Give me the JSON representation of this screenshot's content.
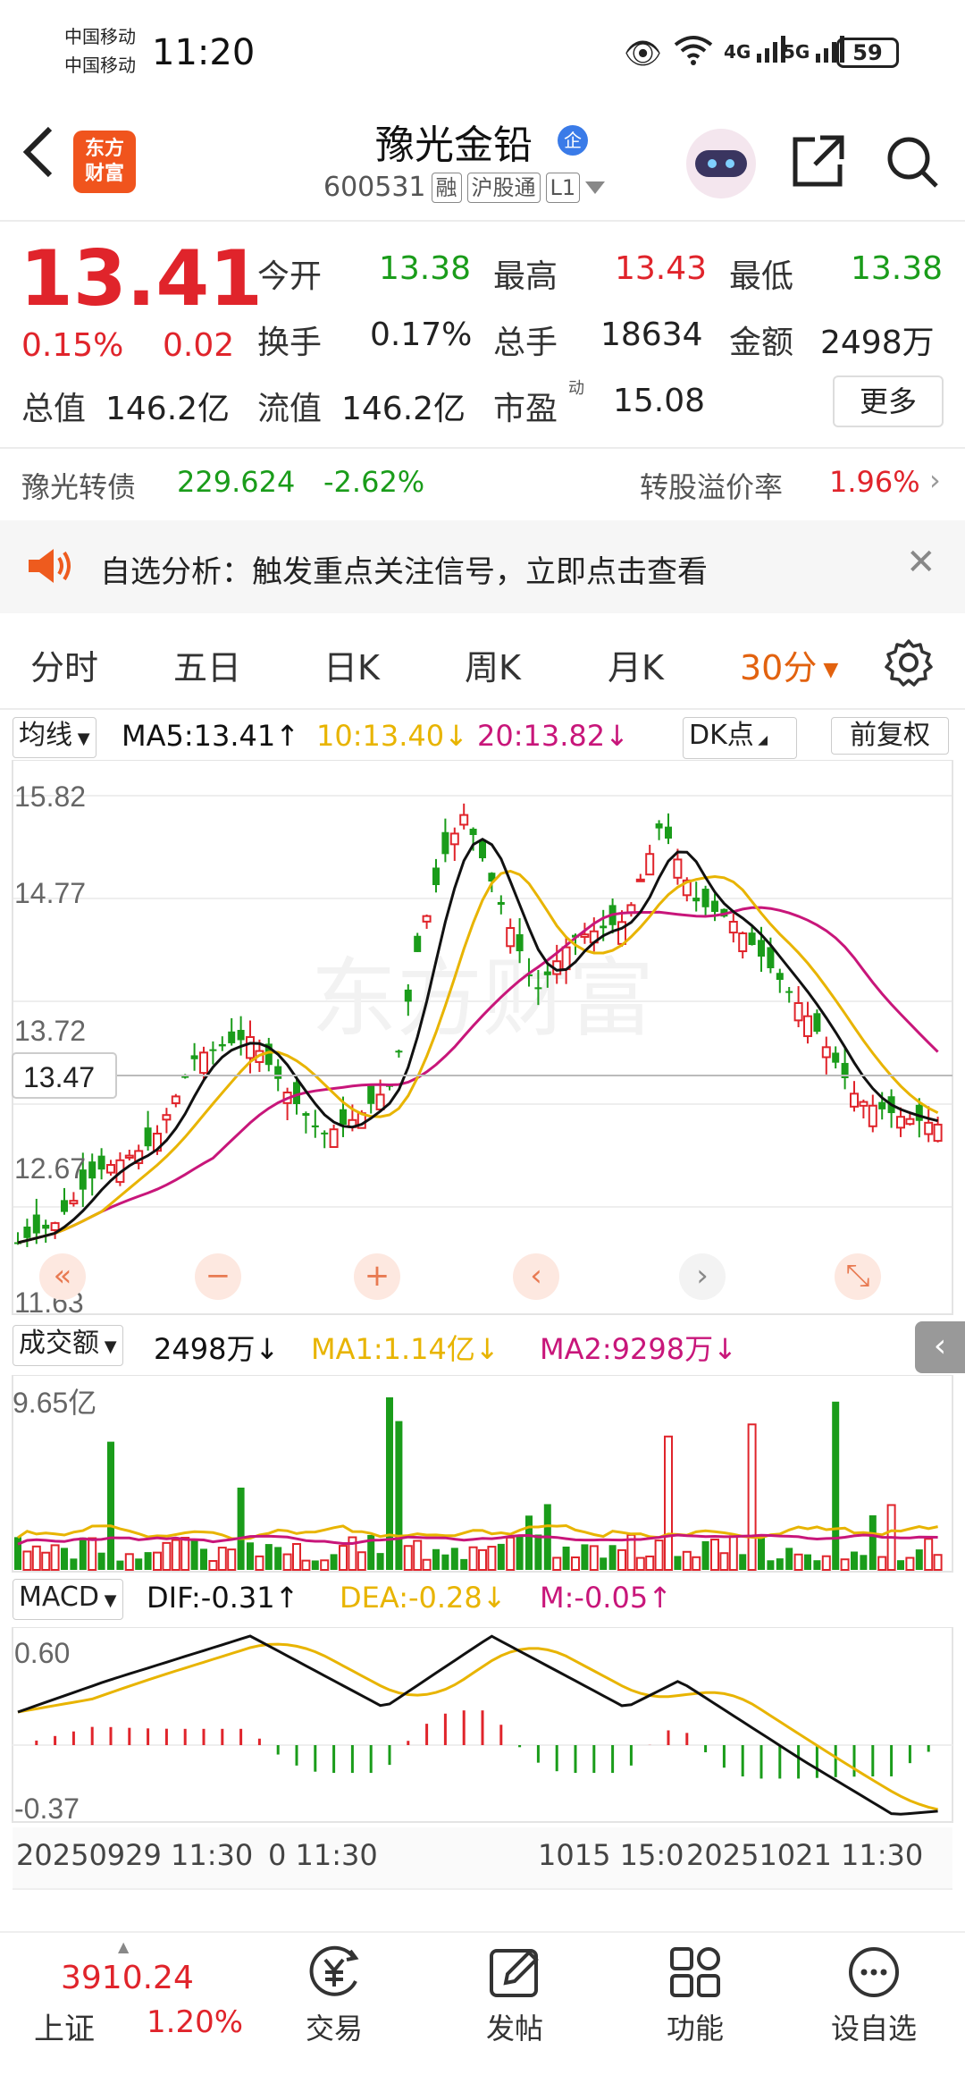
{
  "status_bar": {
    "carrier1": "中国移动",
    "carrier2": "中国移动",
    "time": "11:20",
    "signal1": "4G",
    "signal2": "5G",
    "battery": "59"
  },
  "header": {
    "logo_line1": "东方",
    "logo_line2": "财富",
    "title": "豫光金铅",
    "badge": "企",
    "code": "600531",
    "tags": [
      "融",
      "沪股通",
      "L1"
    ]
  },
  "quote": {
    "price": "13.41",
    "change_pct": "0.15%",
    "change_amt": "0.02",
    "open_label": "今开",
    "open": "13.38",
    "high_label": "最高",
    "high": "13.43",
    "low_label": "最低",
    "low": "13.38",
    "turnover_label": "换手",
    "turnover": "0.17%",
    "volume_label": "总手",
    "volume": "18634",
    "amount_label": "金额",
    "amount": "2498万",
    "mcap_label": "总值",
    "mcap": "146.2亿",
    "float_label": "流值",
    "float": "146.2亿",
    "pe_label": "市盈",
    "pe_sup": "动",
    "pe": "15.08",
    "more": "更多"
  },
  "bond": {
    "name": "豫光转债",
    "price": "229.624",
    "change": "-2.62%",
    "premium_label": "转股溢价率",
    "premium": "1.96%"
  },
  "notice": {
    "text": "自选分析：触发重点关注信号，立即点击查看"
  },
  "tabs": [
    {
      "label": "分时"
    },
    {
      "label": "五日"
    },
    {
      "label": "日K"
    },
    {
      "label": "周K"
    },
    {
      "label": "月K"
    },
    {
      "label": "30分"
    }
  ],
  "main_chart": {
    "indicator": "均线",
    "ma5": "MA5:13.41",
    "ma10": "10:13.40",
    "ma20": "20:13.82",
    "dk": "DK点",
    "adjust": "前复权",
    "y_labels": [
      "15.82",
      "14.77",
      "13.72",
      "12.67",
      "11.63"
    ],
    "current_price": "13.47",
    "watermark": "东方财富"
  },
  "volume_chart": {
    "indicator": "成交额",
    "value": "2498万",
    "ma1": "MA1:1.14亿",
    "ma2": "MA2:9298万",
    "y_max": "9.65亿"
  },
  "macd_chart": {
    "indicator": "MACD",
    "dif": "DIF:-0.31",
    "dea": "DEA:-0.28",
    "m": "M:-0.05",
    "y_top": "0.60",
    "y_bottom": "-0.37"
  },
  "x_axis": {
    "left": "20250929 11:30",
    "mid1": "0 11:30",
    "mid2": "1015 15:0",
    "right": "20251021 11:30"
  },
  "bottom_nav": {
    "index_value": "3910.24",
    "index_name": "上证",
    "index_change": "1.20%",
    "items": [
      {
        "label": "交易",
        "icon": "yen-icon"
      },
      {
        "label": "发帖",
        "icon": "edit-icon"
      },
      {
        "label": "功能",
        "icon": "grid-icon"
      },
      {
        "label": "设自选",
        "icon": "more-icon"
      }
    ]
  },
  "colors": {
    "up": "#e0242b",
    "down": "#1a9c1a",
    "ma5": "#111111",
    "ma10": "#e8b400",
    "ma20": "#c8167a",
    "accent": "#e2620f"
  }
}
